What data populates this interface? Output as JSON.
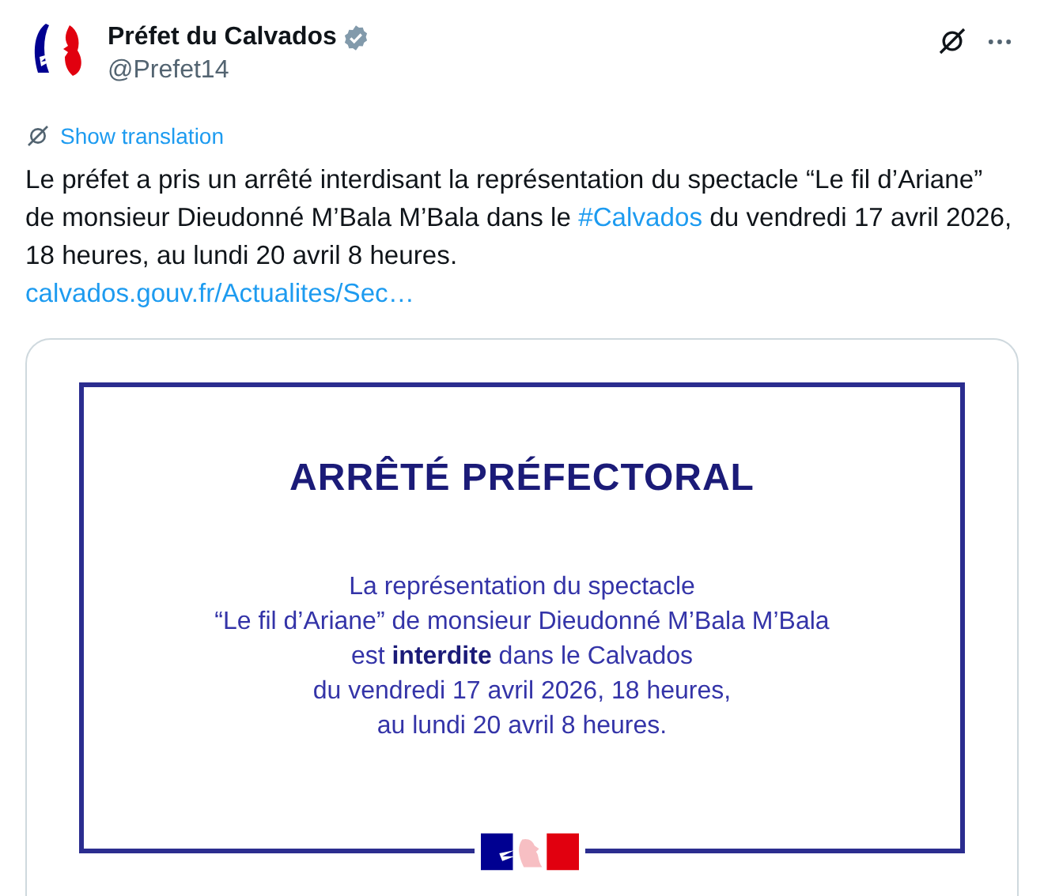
{
  "author": {
    "name": "Préfet du Calvados",
    "verified": true,
    "handle": "@Prefet14"
  },
  "translation_link": "Show translation",
  "text": {
    "before": "Le préfet a pris un arrêté interdisant la représentation du spectacle “Le fil d’Ariane” de monsieur Dieudonné M’Bala M’Bala dans le ",
    "hashtag": "#Calvados",
    "after": " du vendredi 17 avril 2026, 18 heures, au lundi 20 avril 8 heures."
  },
  "link": "calvados.gouv.fr/Actualites/Sec…",
  "media": {
    "title": "ARRÊTÉ PRÉFECTORAL",
    "lines": [
      "La représentation du spectacle",
      "“Le fil d’Ariane” de monsieur Dieudonné M’Bala M’Bala",
      "est **interdite** dans le Calvados",
      "du vendredi 17 avril 2026, 18 heures,",
      "au lundi 20 avril 8 heures."
    ]
  }
}
